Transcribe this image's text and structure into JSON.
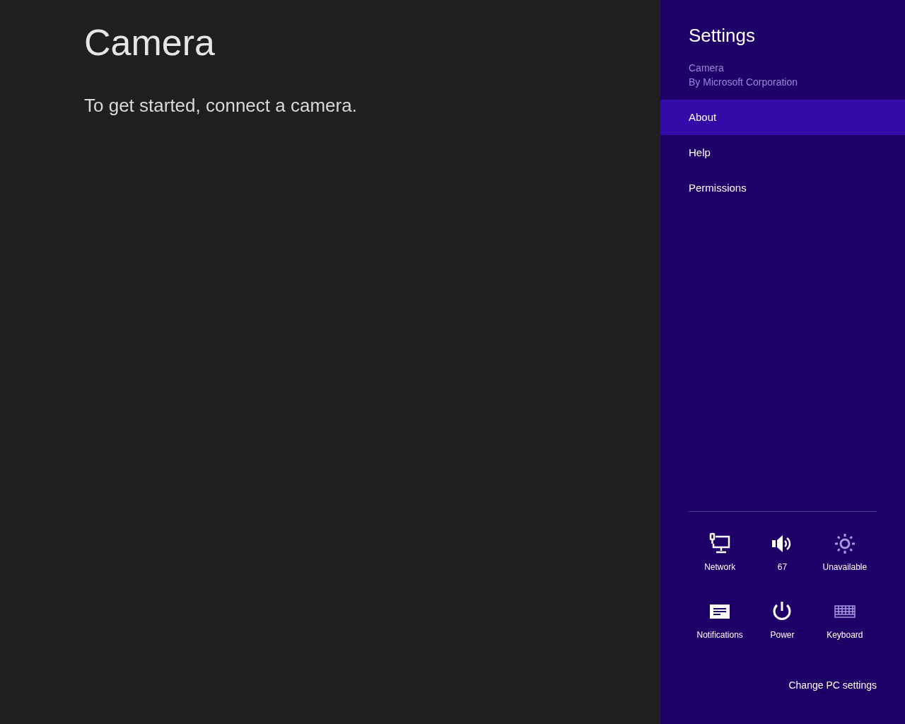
{
  "app": {
    "title": "Camera",
    "message": "To get started, connect a camera."
  },
  "settings_pane": {
    "title": "Settings",
    "app_name": "Camera",
    "publisher": "By Microsoft Corporation",
    "items": [
      {
        "label": "About",
        "selected": true
      },
      {
        "label": "Help",
        "selected": false
      },
      {
        "label": "Permissions",
        "selected": false
      }
    ],
    "tiles": [
      {
        "kind": "network",
        "label": "Network",
        "disabled": false
      },
      {
        "kind": "volume",
        "label": "67",
        "disabled": false
      },
      {
        "kind": "brightness",
        "label": "Unavailable",
        "disabled": true
      },
      {
        "kind": "notifications",
        "label": "Notifications",
        "disabled": false
      },
      {
        "kind": "power",
        "label": "Power",
        "disabled": false
      },
      {
        "kind": "keyboard",
        "label": "Keyboard",
        "disabled": true
      }
    ],
    "footer_link": "Change PC settings"
  }
}
